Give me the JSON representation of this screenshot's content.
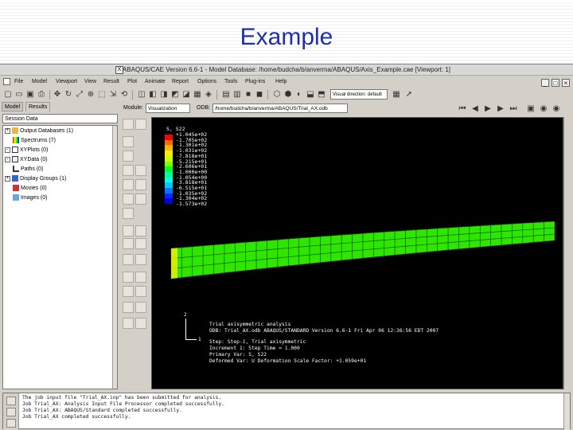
{
  "slide": {
    "title": "Example"
  },
  "window": {
    "title": "ABAQUS/CAE Version 6.6-1 - Model Database: /home/budcha/b/anverma/ABAQUS/Axis_Example.cae [Viewport: 1]",
    "close_glyph": "X"
  },
  "menu": {
    "items": [
      "File",
      "Model",
      "Viewport",
      "View",
      "Result",
      "Plot",
      "Animate",
      "Report",
      "Options",
      "Tools",
      "Plug-ins",
      "Help"
    ]
  },
  "toolbar": {
    "visibility_select": "Visual direction: default"
  },
  "tabs": [
    "Model",
    "Results"
  ],
  "context": {
    "module_label": "Module:",
    "module_value": "Visualization",
    "odb_label": "ODB:",
    "odb_value": "/home/budcha/b/anverma/ABAQUS/Trial_AX.odb"
  },
  "tree": {
    "filter": "Session Data",
    "items": [
      {
        "label": "Output Databases (1)",
        "expander": "+"
      },
      {
        "label": "Spectrums (7)",
        "expander": ""
      },
      {
        "label": "XYPlots (0)",
        "expander": "-"
      },
      {
        "label": "XYData (0)",
        "expander": "-"
      },
      {
        "label": "Paths (0)",
        "expander": ""
      },
      {
        "label": "Display Groups (1)",
        "expander": "+"
      },
      {
        "label": "Movies (0)",
        "expander": ""
      },
      {
        "label": "Images (0)",
        "expander": ""
      }
    ]
  },
  "legend": {
    "title": "S, S22",
    "colors": [
      "#ff0000",
      "#ff6a00",
      "#ffb400",
      "#ffee00",
      "#c8ff00",
      "#78ff00",
      "#00ff28",
      "#00ff96",
      "#00ffe6",
      "#00c8ff",
      "#0078ff",
      "#0028ff",
      "#0000e6"
    ],
    "values": [
      "+1.045e+02",
      "-1.705e+02",
      "-1.301e+02",
      "-1.031e+02",
      "-7.818e+01",
      "-5.215e+01",
      "-2.606e+01",
      "-1.000e+00",
      "-1.054e+00",
      "-3.818e+01",
      "-6.515e+01",
      "-1.035e+02",
      "-1.304e+02",
      "-1.573e+02"
    ]
  },
  "triad": {
    "axis2": "2",
    "axis1": "1"
  },
  "viewport_info": {
    "lines": [
      "Trial axisymmetric analysis",
      "ODB: Trial_AX.odb    ABAQUS/STANDARD Version 6.6-1    Fri Apr 06 12:36:56 EDT 2007",
      "",
      "Step: Step-1, Trial axisymmetric",
      "Increment     1: Step Time =    1.000",
      "Primary Var: S, S22",
      "Deformed Var: U   Deformation Scale Factor: +1.059e+01"
    ]
  },
  "messages": {
    "lines": [
      "The job input file \"Trial_AX.inp\" has been submitted for analysis.",
      "Job Trial_AX: Analysis Input File Processor completed successfully.",
      "Job Trial_AX: ABAQUS/Standard completed successfully.",
      "Job Trial_AX completed successfully."
    ]
  },
  "model": {
    "mesh_color": "#2ee600",
    "mesh_edge_color": "#0c5a00"
  }
}
